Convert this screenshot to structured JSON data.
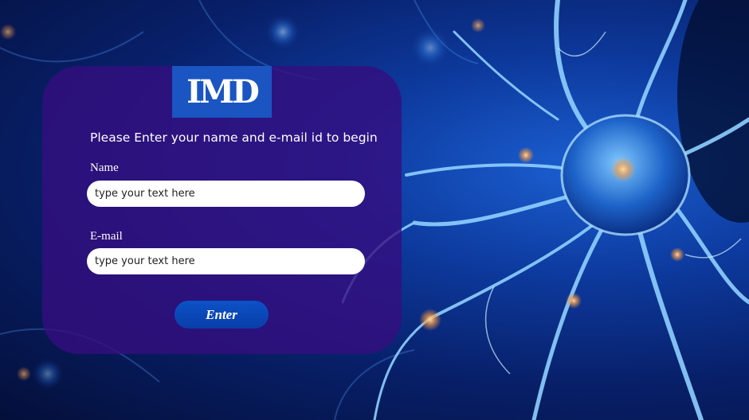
{
  "logo": {
    "text": "IMD",
    "color": "#1a55c2"
  },
  "form": {
    "prompt": "Please Enter your name and e-mail id to begin",
    "name_label": "Name",
    "name_placeholder": "type your text here",
    "email_label": "E-mail",
    "email_placeholder": "type your text here",
    "enter_label": "Enter"
  },
  "colors": {
    "panel": "#340e80",
    "button": "#0b52c7",
    "background": "#0d3a9e"
  }
}
